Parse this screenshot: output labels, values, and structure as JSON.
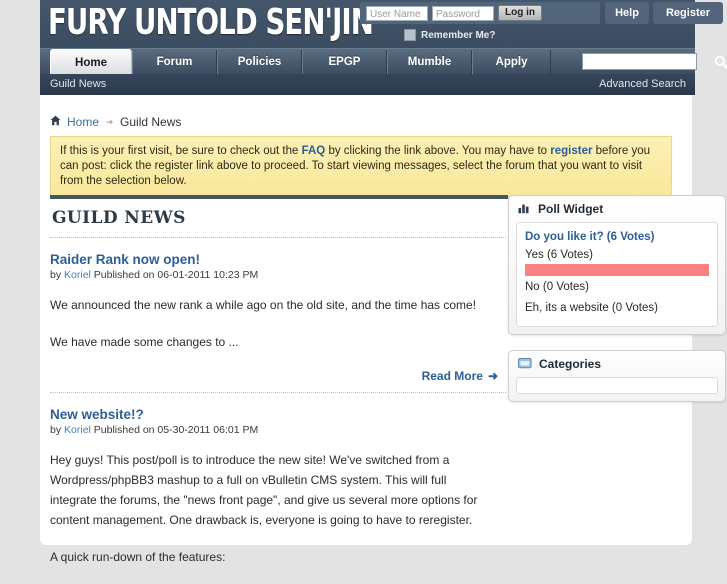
{
  "site": {
    "logo_text": "FURY UNTOLD SEN'JIN"
  },
  "login": {
    "username_placeholder": "User Name",
    "password_placeholder": "Password",
    "login_button": "Log in",
    "remember_label": "Remember Me?"
  },
  "header_buttons": {
    "help": "Help",
    "register": "Register"
  },
  "nav": {
    "tabs": [
      {
        "label": "Home",
        "active": true
      },
      {
        "label": "Forum",
        "active": false
      },
      {
        "label": "Policies",
        "active": false
      },
      {
        "label": "EPGP",
        "active": false
      },
      {
        "label": "Mumble",
        "active": false
      },
      {
        "label": "Apply",
        "active": false
      }
    ],
    "search_value": "",
    "search_icon": "magnifier-icon"
  },
  "subnav": {
    "left_label": "Guild News",
    "right_label": "Advanced Search"
  },
  "breadcrumb": {
    "home_icon": "house-icon",
    "home": "Home",
    "separator_icon": "arrow-separator-icon",
    "current": "Guild News"
  },
  "notice": {
    "part1": "If this is your first visit, be sure to check out the ",
    "faq": "FAQ",
    "part2": " by clicking the link above. You may have to ",
    "register": "register",
    "part3": " before you can post: click the register link above to proceed. To start viewing messages, select the forum that you want to visit from the selection below."
  },
  "main": {
    "section_title": "GUILD NEWS",
    "articles": [
      {
        "title": "Raider Rank now open!",
        "by": "by",
        "author": "Koriel",
        "published": "Published on 06-01-2011 10:23 PM",
        "paragraphs": [
          "We announced the new rank a while ago on the old site, and the time has come!",
          "We have made some changes to ..."
        ],
        "read_more": "Read More",
        "read_more_arrow": "➜"
      },
      {
        "title": "New website!?",
        "by": "by",
        "author": "Koriel",
        "published": "Published on 05-30-2011 06:01 PM",
        "paragraphs": [
          "Hey guys! This post/poll is to introduce the new site! We've switched from a Wordpress/phpBB3 mashup to a full on vBulletin CMS system. This will full integrate the forums, the \"news front page\", and give us several more options for content management. One drawback is, everyone is going to have to reregister.",
          "A quick run-down of the features:"
        ]
      }
    ]
  },
  "sidebar": {
    "poll_widget": {
      "icon": "bar-chart-icon",
      "title": "Poll Widget",
      "question": "Do you like it? (6 Votes)",
      "options": [
        {
          "label": "Yes (6 Votes)",
          "votes": 6,
          "percent": 100
        },
        {
          "label": "No (0 Votes)",
          "votes": 0,
          "percent": 0
        },
        {
          "label": "Eh, its a website (0 Votes)",
          "votes": 0,
          "percent": 0
        }
      ],
      "bar_color": "#fb8080"
    },
    "categories_widget": {
      "icon": "folder-icon",
      "title": "Categories"
    }
  },
  "colors": {
    "header_navy": "#3d4f63",
    "accent_link": "#2c5f95",
    "notice_yellow": "#fbecaa",
    "page_bg": "#e3e3e3"
  }
}
